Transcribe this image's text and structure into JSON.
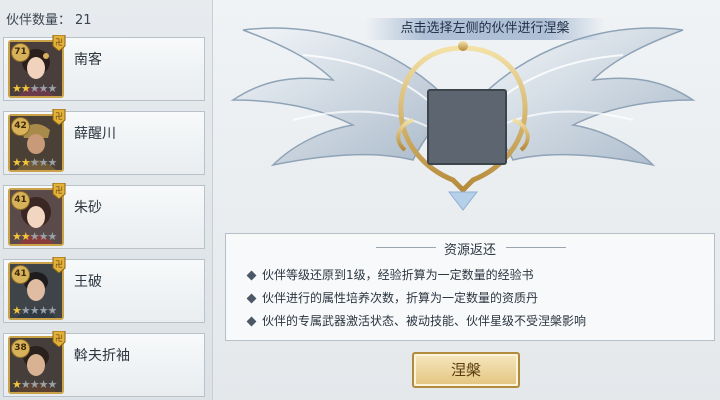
{
  "left_panel": {
    "count_label": "伙伴数量：",
    "count_value": "21",
    "partners": [
      {
        "level": "71",
        "name": "南客",
        "stars_filled": 2,
        "stars_total": 5
      },
      {
        "level": "42",
        "name": "薛醒川",
        "stars_filled": 2,
        "stars_total": 5
      },
      {
        "level": "41",
        "name": "朱砂",
        "stars_filled": 2,
        "stars_total": 5
      },
      {
        "level": "41",
        "name": "王破",
        "stars_filled": 1,
        "stars_total": 5
      },
      {
        "level": "38",
        "name": "斡夫折袖",
        "stars_filled": 1,
        "stars_total": 5
      }
    ]
  },
  "main": {
    "hint": "点击选择左侧的伙伴进行涅槃",
    "info": {
      "title": "资源返还",
      "items": [
        "伙伴等级还原到1级，经验折算为一定数量的经验书",
        "伙伴进行的属性培养次数，折算为一定数量的资质丹",
        "伙伴的专属武器激活状态、被动技能、伙伴星级不受涅槃影响"
      ]
    },
    "button_label": "涅槃"
  },
  "colors": {
    "accent_gold": "#c9a24a",
    "star_on": "#f3c53a",
    "star_off": "#9aa1a8"
  },
  "icons": [
    "seal-icon",
    "star-icon",
    "diamond-bullet-icon"
  ]
}
